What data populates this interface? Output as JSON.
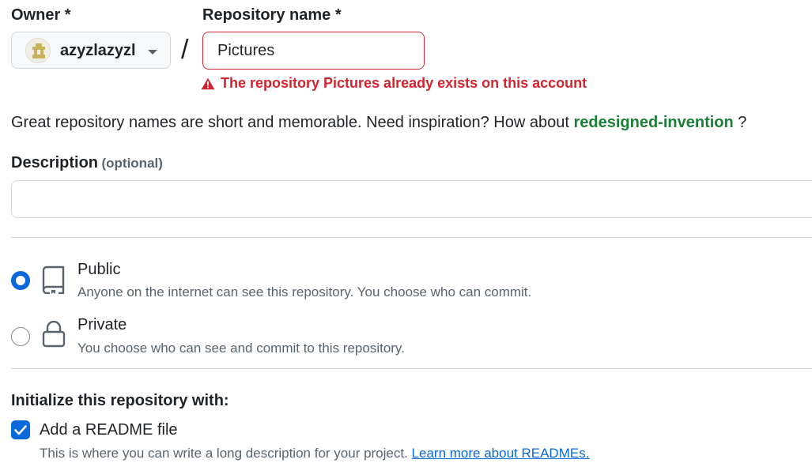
{
  "owner": {
    "label": "Owner *",
    "selected": "azyzlazyzl",
    "avatar_icon": "identicon-avatar"
  },
  "separator": "/",
  "repository": {
    "label": "Repository name *",
    "value": "Pictures",
    "error": "The repository Pictures already exists on this account",
    "error_color": "#d1242f"
  },
  "hint": {
    "text": "Great repository names are short and memorable. Need inspiration? How about ",
    "suggestion": "redesigned-invention",
    "suffix": " ?",
    "suggestion_color": "#1a7f37"
  },
  "description": {
    "label": "Description",
    "optional": "(optional)",
    "value": ""
  },
  "visibility": {
    "options": [
      {
        "title": "Public",
        "desc": "Anyone on the internet can see this repository. You choose who can commit.",
        "icon": "repo-icon",
        "checked": true
      },
      {
        "title": "Private",
        "desc": "You choose who can see and commit to this repository.",
        "icon": "lock-icon",
        "checked": false
      }
    ]
  },
  "init": {
    "title": "Initialize this repository with:",
    "readme_label": "Add a README file",
    "readme_checked": true,
    "readme_desc": "This is where you can write a long description for your project. ",
    "readme_link": "Learn more about READMEs."
  },
  "colors": {
    "accent": "#0969da",
    "border": "#d1d9e0"
  }
}
